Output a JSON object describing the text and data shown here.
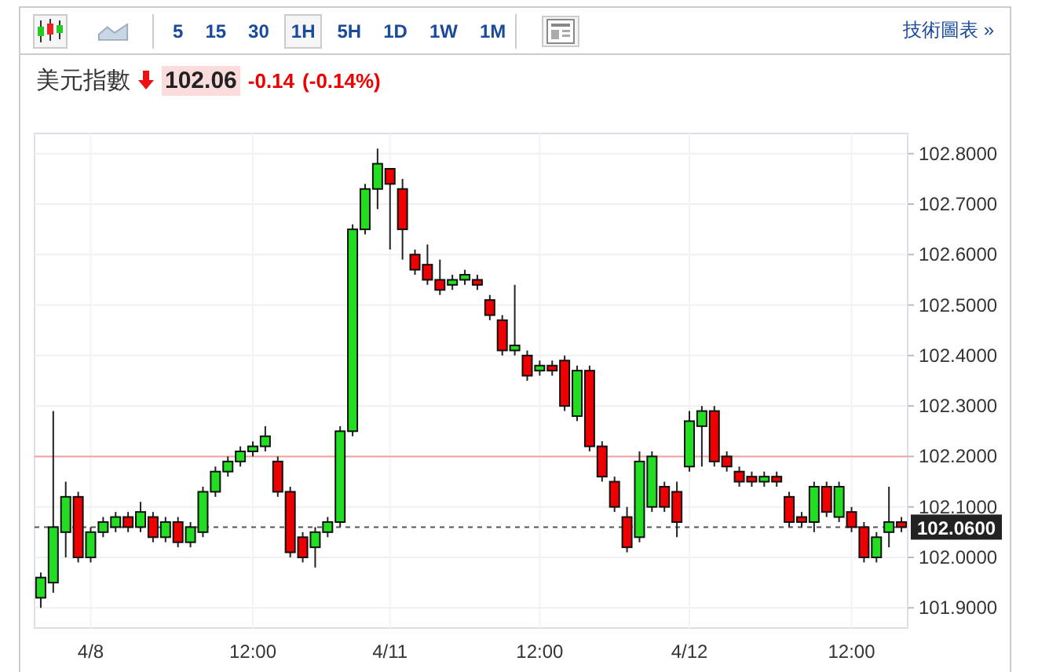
{
  "toolbar": {
    "chart_types": [
      {
        "kind": "candlestick",
        "selected": true
      },
      {
        "kind": "area",
        "selected": false
      }
    ],
    "intervals": [
      {
        "label": "5",
        "selected": false
      },
      {
        "label": "15",
        "selected": false
      },
      {
        "label": "30",
        "selected": false
      },
      {
        "label": "1H",
        "selected": true
      },
      {
        "label": "5H",
        "selected": false
      },
      {
        "label": "1D",
        "selected": false
      },
      {
        "label": "1W",
        "selected": false
      },
      {
        "label": "1M",
        "selected": false
      }
    ],
    "link": "技術圖表 »"
  },
  "quote": {
    "name": "美元指數",
    "falling": true,
    "price": "102.06",
    "change": "-0.14",
    "change_percent": "(-0.14%)"
  },
  "chart": {
    "chart_data": {
      "type": "candlestick",
      "ylim": [
        101.86,
        102.84
      ],
      "grid": true,
      "ref_lines": [
        {
          "axis": "y",
          "value": 102.2,
          "color": "#f4a0a0"
        },
        {
          "axis": "y",
          "value": 102.06,
          "color": "#555555",
          "label": "102.0600"
        }
      ],
      "yticks": [
        {
          "value": 102.8,
          "label": "102.8000"
        },
        {
          "value": 102.7,
          "label": "102.7000"
        },
        {
          "value": 102.6,
          "label": "102.6000"
        },
        {
          "value": 102.5,
          "label": "102.5000"
        },
        {
          "value": 102.4,
          "label": "102.4000"
        },
        {
          "value": 102.3,
          "label": "102.3000"
        },
        {
          "value": 102.2,
          "label": "102.2000"
        },
        {
          "value": 102.1,
          "label": "102.1000"
        },
        {
          "value": 102.0,
          "label": "102.0000"
        },
        {
          "value": 101.9,
          "label": "101.9000"
        }
      ],
      "categories": [
        null,
        null,
        null,
        null,
        "4/8",
        null,
        null,
        null,
        null,
        null,
        null,
        null,
        null,
        null,
        null,
        null,
        null,
        "12:00",
        null,
        null,
        null,
        null,
        null,
        null,
        null,
        null,
        null,
        null,
        "4/11",
        null,
        null,
        null,
        null,
        null,
        null,
        null,
        null,
        null,
        null,
        null,
        "12:00",
        null,
        null,
        null,
        null,
        null,
        null,
        null,
        null,
        null,
        null,
        null,
        "4/12",
        null,
        null,
        null,
        null,
        null,
        null,
        null,
        null,
        null,
        null,
        null,
        null,
        "12:00",
        null,
        null,
        null,
        null
      ],
      "ohlc": [
        [
          101.92,
          101.97,
          101.9,
          101.96
        ],
        [
          101.95,
          102.29,
          101.93,
          102.06
        ],
        [
          102.05,
          102.15,
          102.0,
          102.12
        ],
        [
          102.12,
          102.13,
          101.99,
          102.0
        ],
        [
          102.0,
          102.06,
          101.99,
          102.05
        ],
        [
          102.05,
          102.08,
          102.04,
          102.07
        ],
        [
          102.06,
          102.09,
          102.05,
          102.08
        ],
        [
          102.08,
          102.09,
          102.05,
          102.06
        ],
        [
          102.06,
          102.11,
          102.05,
          102.09
        ],
        [
          102.08,
          102.09,
          102.03,
          102.04
        ],
        [
          102.04,
          102.08,
          102.03,
          102.07
        ],
        [
          102.07,
          102.08,
          102.02,
          102.03
        ],
        [
          102.03,
          102.07,
          102.02,
          102.06
        ],
        [
          102.05,
          102.14,
          102.04,
          102.13
        ],
        [
          102.13,
          102.18,
          102.12,
          102.17
        ],
        [
          102.17,
          102.2,
          102.16,
          102.19
        ],
        [
          102.19,
          102.22,
          102.18,
          102.21
        ],
        [
          102.21,
          102.23,
          102.2,
          102.22
        ],
        [
          102.22,
          102.26,
          102.21,
          102.24
        ],
        [
          102.19,
          102.2,
          102.12,
          102.13
        ],
        [
          102.13,
          102.14,
          102.0,
          102.01
        ],
        [
          102.04,
          102.05,
          101.99,
          102.0
        ],
        [
          102.02,
          102.06,
          101.98,
          102.05
        ],
        [
          102.05,
          102.08,
          102.04,
          102.07
        ],
        [
          102.07,
          102.26,
          102.06,
          102.25
        ],
        [
          102.25,
          102.66,
          102.24,
          102.65
        ],
        [
          102.65,
          102.74,
          102.64,
          102.73
        ],
        [
          102.73,
          102.81,
          102.69,
          102.78
        ],
        [
          102.77,
          102.77,
          102.61,
          102.74
        ],
        [
          102.73,
          102.75,
          102.59,
          102.65
        ],
        [
          102.6,
          102.61,
          102.56,
          102.57
        ],
        [
          102.58,
          102.62,
          102.54,
          102.55
        ],
        [
          102.55,
          102.59,
          102.52,
          102.53
        ],
        [
          102.54,
          102.56,
          102.53,
          102.55
        ],
        [
          102.55,
          102.57,
          102.54,
          102.56
        ],
        [
          102.55,
          102.56,
          102.53,
          102.54
        ],
        [
          102.51,
          102.52,
          102.47,
          102.48
        ],
        [
          102.47,
          102.48,
          102.4,
          102.41
        ],
        [
          102.41,
          102.54,
          102.4,
          102.42
        ],
        [
          102.4,
          102.41,
          102.35,
          102.36
        ],
        [
          102.37,
          102.39,
          102.36,
          102.38
        ],
        [
          102.38,
          102.39,
          102.36,
          102.37
        ],
        [
          102.39,
          102.4,
          102.29,
          102.3
        ],
        [
          102.28,
          102.38,
          102.27,
          102.37
        ],
        [
          102.37,
          102.38,
          102.21,
          102.22
        ],
        [
          102.22,
          102.23,
          102.15,
          102.16
        ],
        [
          102.15,
          102.16,
          102.09,
          102.1
        ],
        [
          102.08,
          102.1,
          102.01,
          102.02
        ],
        [
          102.04,
          102.21,
          102.03,
          102.19
        ],
        [
          102.1,
          102.21,
          102.09,
          102.2
        ],
        [
          102.14,
          102.15,
          102.09,
          102.1
        ],
        [
          102.13,
          102.15,
          102.04,
          102.07
        ],
        [
          102.18,
          102.29,
          102.17,
          102.27
        ],
        [
          102.26,
          102.3,
          102.18,
          102.29
        ],
        [
          102.29,
          102.3,
          102.18,
          102.19
        ],
        [
          102.2,
          102.21,
          102.17,
          102.18
        ],
        [
          102.17,
          102.18,
          102.14,
          102.15
        ],
        [
          102.16,
          102.17,
          102.14,
          102.15
        ],
        [
          102.15,
          102.17,
          102.14,
          102.16
        ],
        [
          102.16,
          102.17,
          102.14,
          102.15
        ],
        [
          102.12,
          102.13,
          102.06,
          102.07
        ],
        [
          102.08,
          102.09,
          102.06,
          102.07
        ],
        [
          102.07,
          102.15,
          102.05,
          102.14
        ],
        [
          102.14,
          102.15,
          102.08,
          102.09
        ],
        [
          102.08,
          102.15,
          102.07,
          102.14
        ],
        [
          102.09,
          102.1,
          102.05,
          102.06
        ],
        [
          102.06,
          102.07,
          101.99,
          102.0
        ],
        [
          102.0,
          102.05,
          101.99,
          102.04
        ],
        [
          102.05,
          102.14,
          102.02,
          102.07
        ],
        [
          102.07,
          102.08,
          102.05,
          102.06
        ]
      ]
    }
  }
}
